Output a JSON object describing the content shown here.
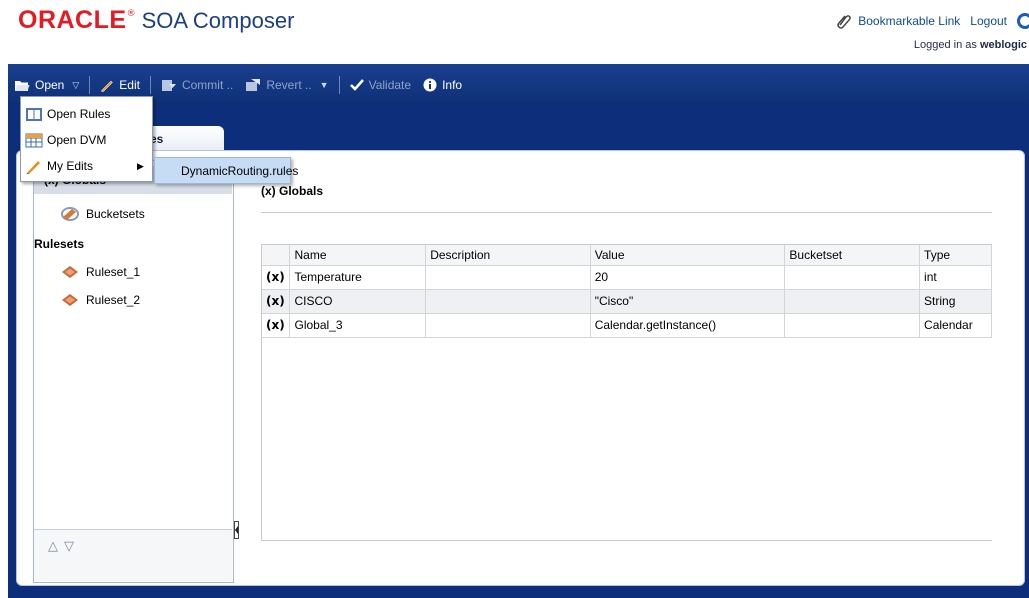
{
  "app": {
    "brand": "ORACLE",
    "product": "SOA Composer",
    "bookmark_label": "Bookmarkable Link",
    "logout_label": "Logout",
    "logged_in_prefix": "Logged in as",
    "username": "weblogic"
  },
  "toolbar": {
    "open": "Open",
    "edit": "Edit",
    "commit": "Commit ..",
    "revert": "Revert ..",
    "validate": "Validate",
    "info": "Info"
  },
  "open_menu": {
    "items": [
      "Open Rules",
      "Open DVM",
      "My Edits"
    ],
    "submenu_item": "DynamicRouting.rules"
  },
  "tab": {
    "label": "g.rules"
  },
  "nav": {
    "globals_label": "(x) Globals",
    "bucketsets_label": "Bucketsets",
    "rulesets_heading": "Rulesets",
    "rulesets": [
      "Ruleset_1",
      "Ruleset_2"
    ]
  },
  "content": {
    "title": "(x) Globals",
    "columns": [
      "",
      "Name",
      "Description",
      "Value",
      "Bucketset",
      "Type"
    ],
    "rows": [
      {
        "icon": "(x)",
        "name": "Temperature",
        "description": "",
        "value": "20",
        "bucketset": "",
        "type": "int"
      },
      {
        "icon": "(x)",
        "name": "CISCO",
        "description": "",
        "value": "\"Cisco\"",
        "bucketset": "",
        "type": "String"
      },
      {
        "icon": "(x)",
        "name": "Global_3",
        "description": "",
        "value": "Calendar.getInstance()",
        "bucketset": "",
        "type": "Calendar"
      }
    ]
  },
  "colors": {
    "oracle_red": "#e51b24",
    "workspace_blue": "#0d2f7b",
    "link_blue": "#0f4b8f",
    "submenu_highlight": "#c6dcf4"
  }
}
